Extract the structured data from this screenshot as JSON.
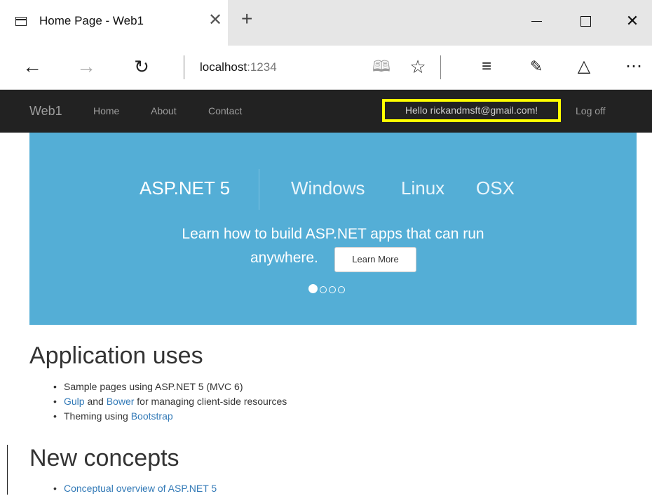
{
  "browser": {
    "tab_title": "Home Page - Web1",
    "tab_close_glyph": "✕",
    "new_tab_glyph": "+",
    "window_close_glyph": "✕",
    "url_host": "localhost",
    "url_port": ":1234",
    "icons": [
      "tab-page-icon",
      "back-arrow-icon",
      "forward-arrow-icon",
      "refresh-icon",
      "reading-view-icon",
      "favorite-star-icon",
      "hub-icon",
      "web-note-icon",
      "share-icon",
      "more-icon",
      "minimize-icon",
      "maximize-icon",
      "close-icon"
    ]
  },
  "site": {
    "brand": "Web1",
    "nav": {
      "home": "Home",
      "about": "About",
      "contact": "Contact"
    },
    "hello": "Hello rickandmsft@gmail.com!",
    "logoff": "Log off",
    "highlight_color": "#ffff00",
    "navbar_color": "#222222"
  },
  "carousel": {
    "logo": "ASP.NET 5",
    "platforms": [
      "Windows",
      "Linux",
      "OSX"
    ],
    "text_line1": "Learn how to build ASP.NET apps that can run",
    "text_line2": "anywhere.",
    "button": "Learn More",
    "background_color": "#54aed6",
    "slides": 4,
    "active_slide": 1
  },
  "content": {
    "apps_heading": "Application uses",
    "apps_items": [
      {
        "pre": "Sample pages using ASP.NET 5 (MVC 6)",
        "link": "",
        "link2": "",
        "post": ""
      },
      {
        "link": "Gulp",
        "mid": " and ",
        "link2": "Bower",
        "post": " for managing client-side resources"
      },
      {
        "pre": "Theming using ",
        "link": "Bootstrap"
      }
    ],
    "concepts_heading": "New concepts",
    "concepts_items": [
      "Conceptual overview of ASP.NET 5"
    ]
  }
}
